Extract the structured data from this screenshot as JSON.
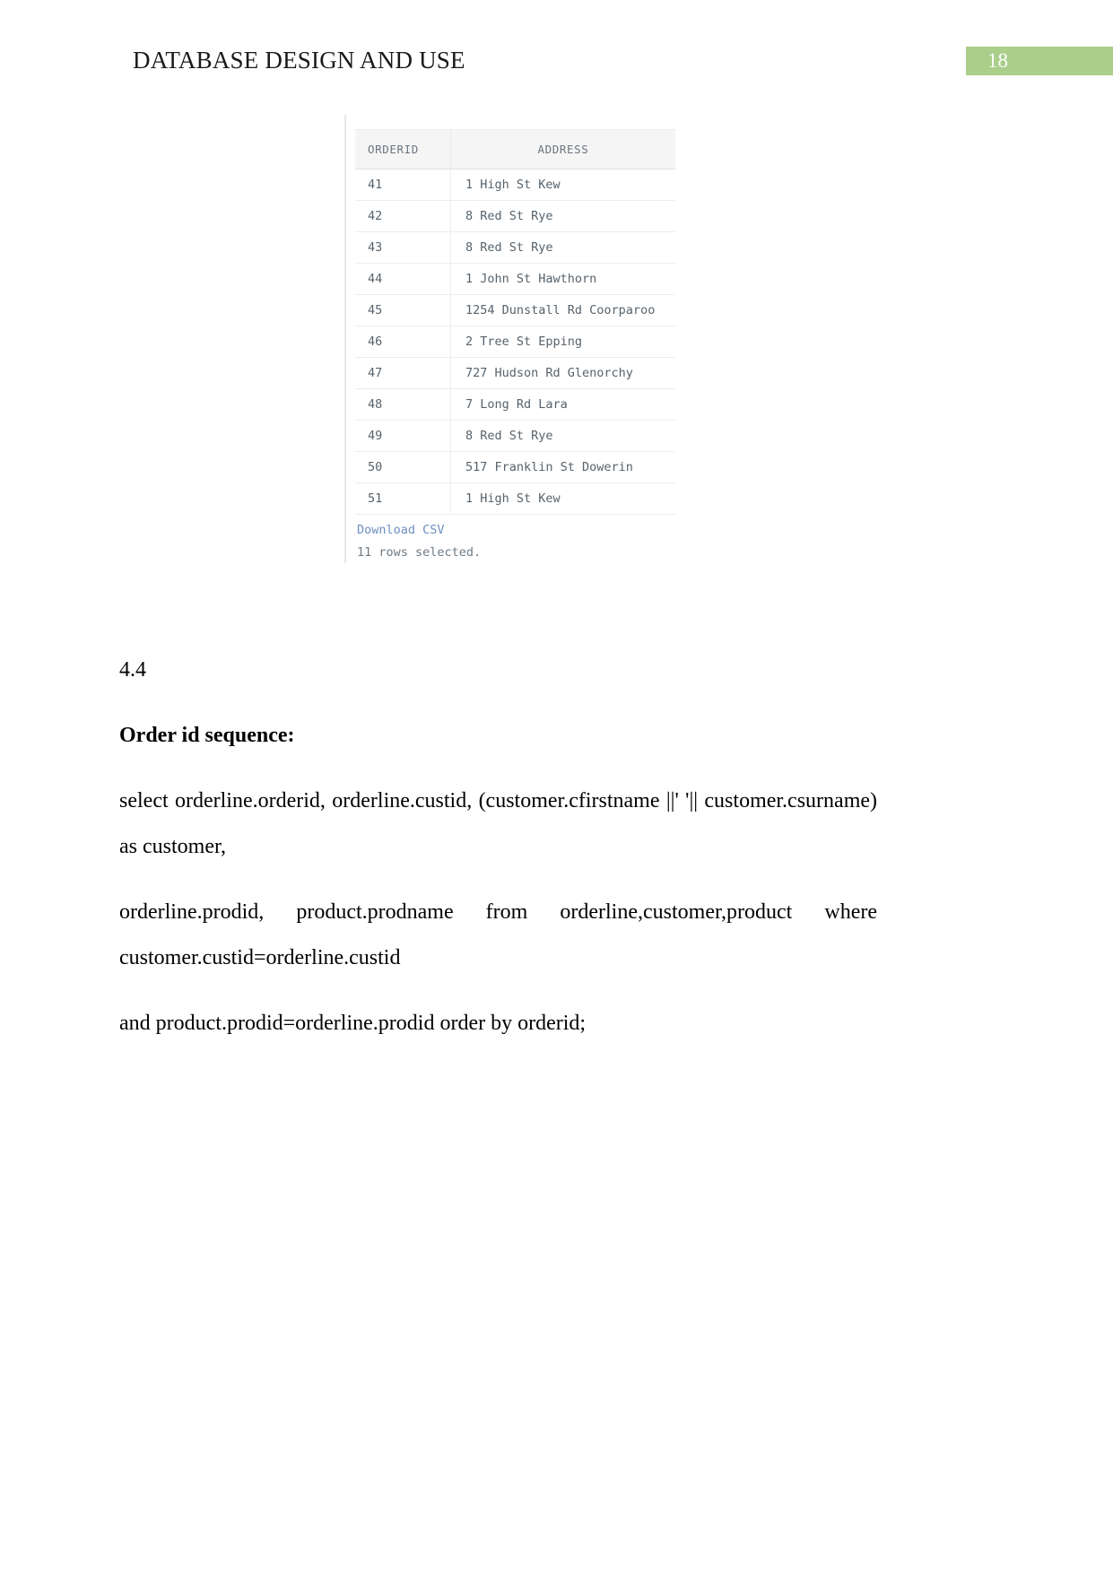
{
  "header": {
    "doc_title": "DATABASE DESIGN AND USE",
    "page_number": "18",
    "badge_color": "#a9cf8a"
  },
  "result_grid": {
    "columns": [
      "ORDERID",
      "ADDRESS"
    ],
    "rows": [
      {
        "orderid": "41",
        "address": "1 High St Kew"
      },
      {
        "orderid": "42",
        "address": "8 Red St Rye"
      },
      {
        "orderid": "43",
        "address": "8 Red St Rye"
      },
      {
        "orderid": "44",
        "address": "1 John St Hawthorn"
      },
      {
        "orderid": "45",
        "address": "1254 Dunstall Rd Coorparoo"
      },
      {
        "orderid": "46",
        "address": "2 Tree St Epping"
      },
      {
        "orderid": "47",
        "address": "727 Hudson Rd Glenorchy"
      },
      {
        "orderid": "48",
        "address": "7 Long Rd Lara"
      },
      {
        "orderid": "49",
        "address": "8 Red St Rye"
      },
      {
        "orderid": "50",
        "address": "517 Franklin St Dowerin"
      },
      {
        "orderid": "51",
        "address": "1 High St Kew"
      }
    ],
    "download_link": "Download CSV",
    "row_count_status": "11 rows selected.",
    "link_color": "#6e8fc0"
  },
  "content": {
    "section_number": "4.4",
    "section_heading": "Order id sequence:",
    "sql_line_1": "select orderline.orderid, orderline.custid, (customer.cfirstname ||' '|| customer.csurname) as customer,",
    "sql_line_2": "orderline.prodid, product.prodname from orderline,customer,product where customer.custid=orderline.custid",
    "sql_line_3": "and product.prodid=orderline.prodid order by orderid;"
  }
}
